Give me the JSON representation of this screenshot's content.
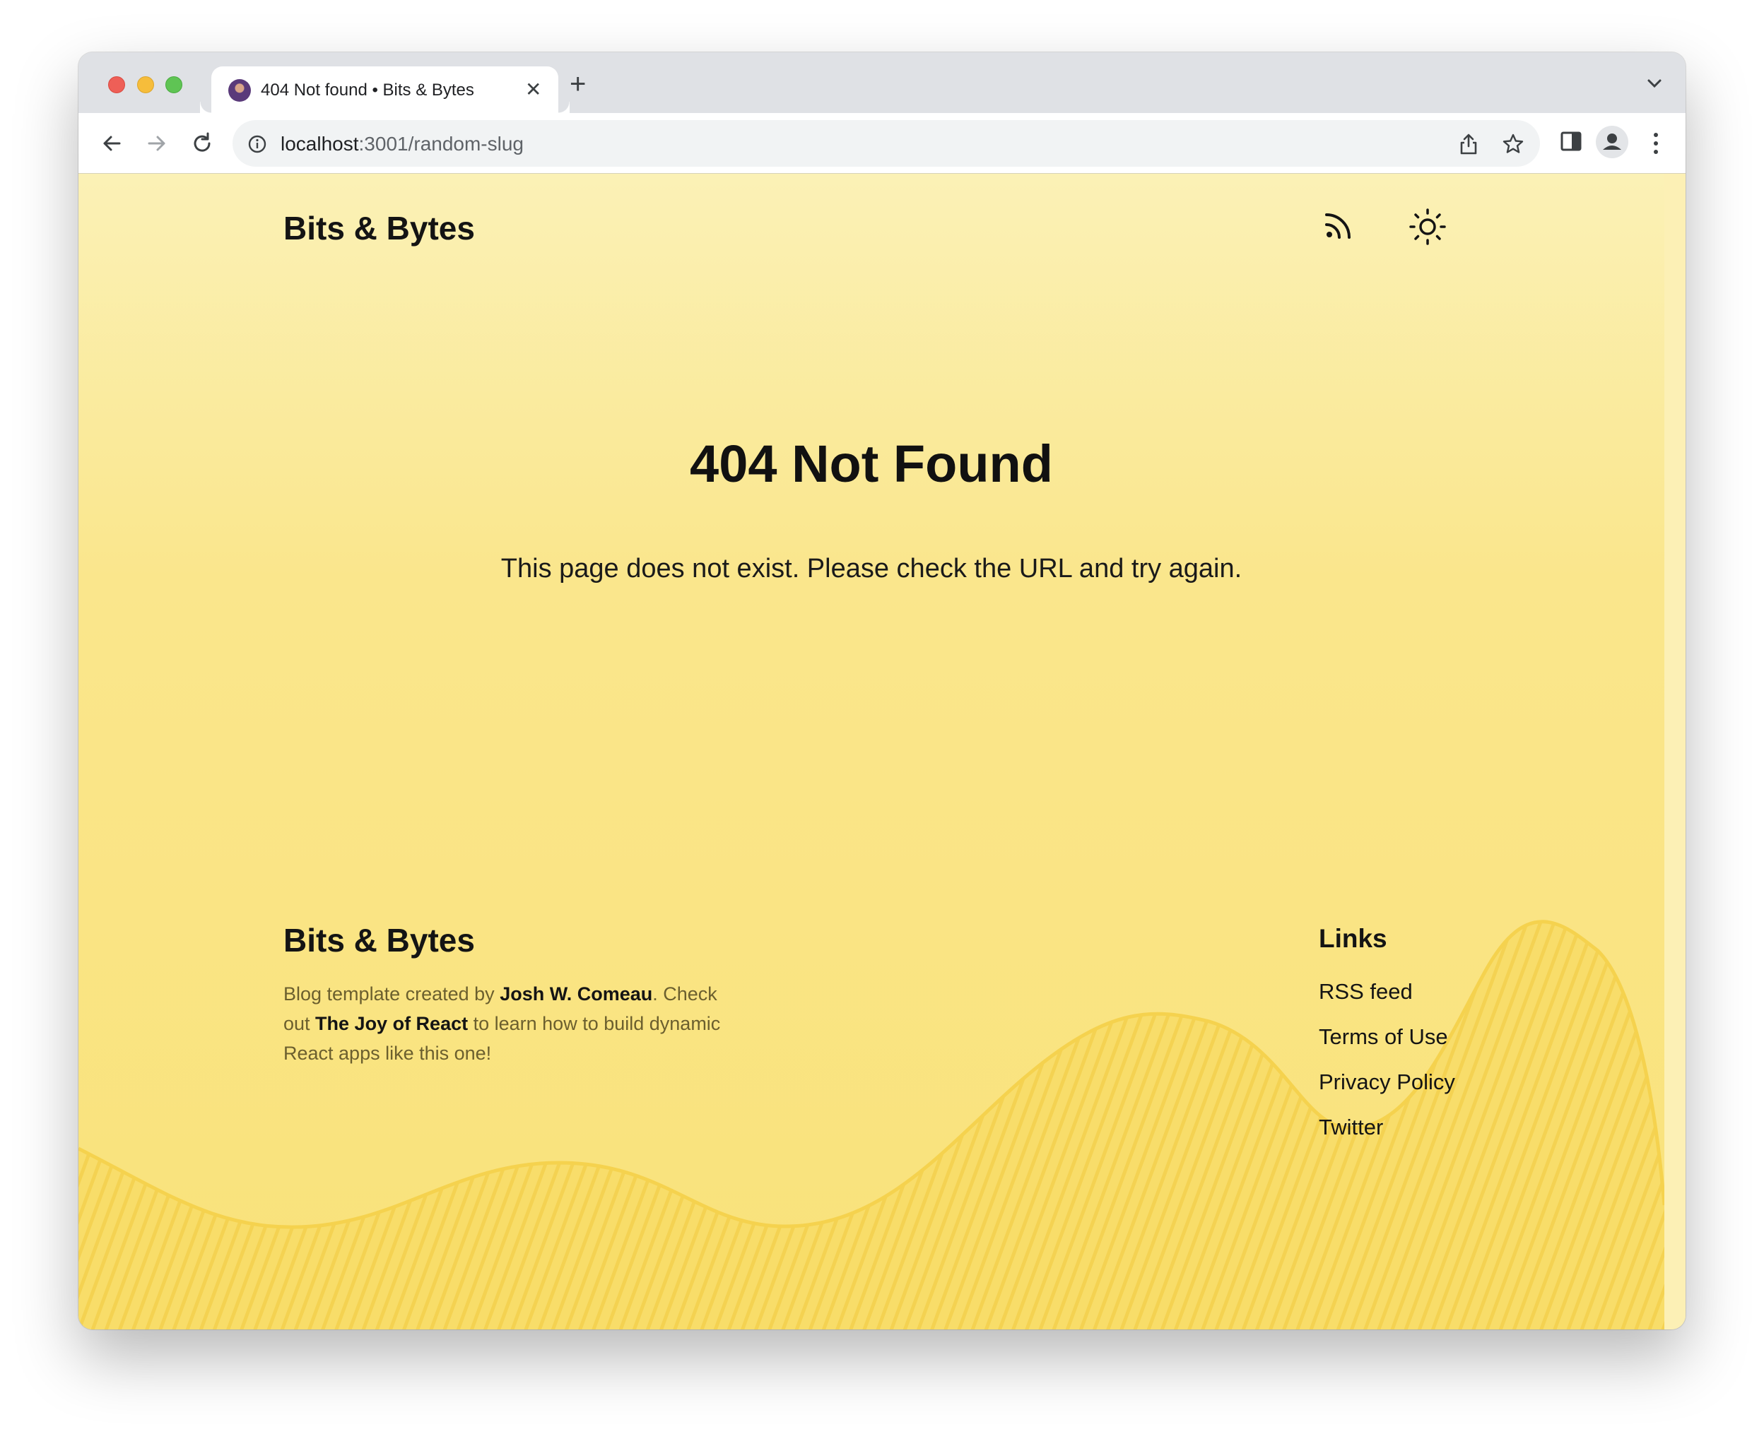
{
  "browser": {
    "tab_title": "404 Not found • Bits & Bytes",
    "tab_close": "✕",
    "new_tab": "+",
    "url_host": "localhost",
    "url_path": ":3001/random-slug"
  },
  "header": {
    "site_title": "Bits & Bytes"
  },
  "main": {
    "heading": "404 Not Found",
    "message": "This page does not exist. Please check the URL and try again."
  },
  "footer": {
    "site_title": "Bits & Bytes",
    "text_1": "Blog template created by ",
    "author": "Josh W. Comeau",
    "text_2": ". Check out ",
    "course": "The Joy of React",
    "text_3": " to learn how to build dynamic React apps like this one!",
    "links_title": "Links",
    "links": [
      "RSS feed",
      "Terms of Use",
      "Privacy Policy",
      "Twitter"
    ]
  },
  "colors": {
    "page_top": "#fbf1b6",
    "page_bottom": "#f9e27a",
    "wave": "#f6d95a"
  }
}
